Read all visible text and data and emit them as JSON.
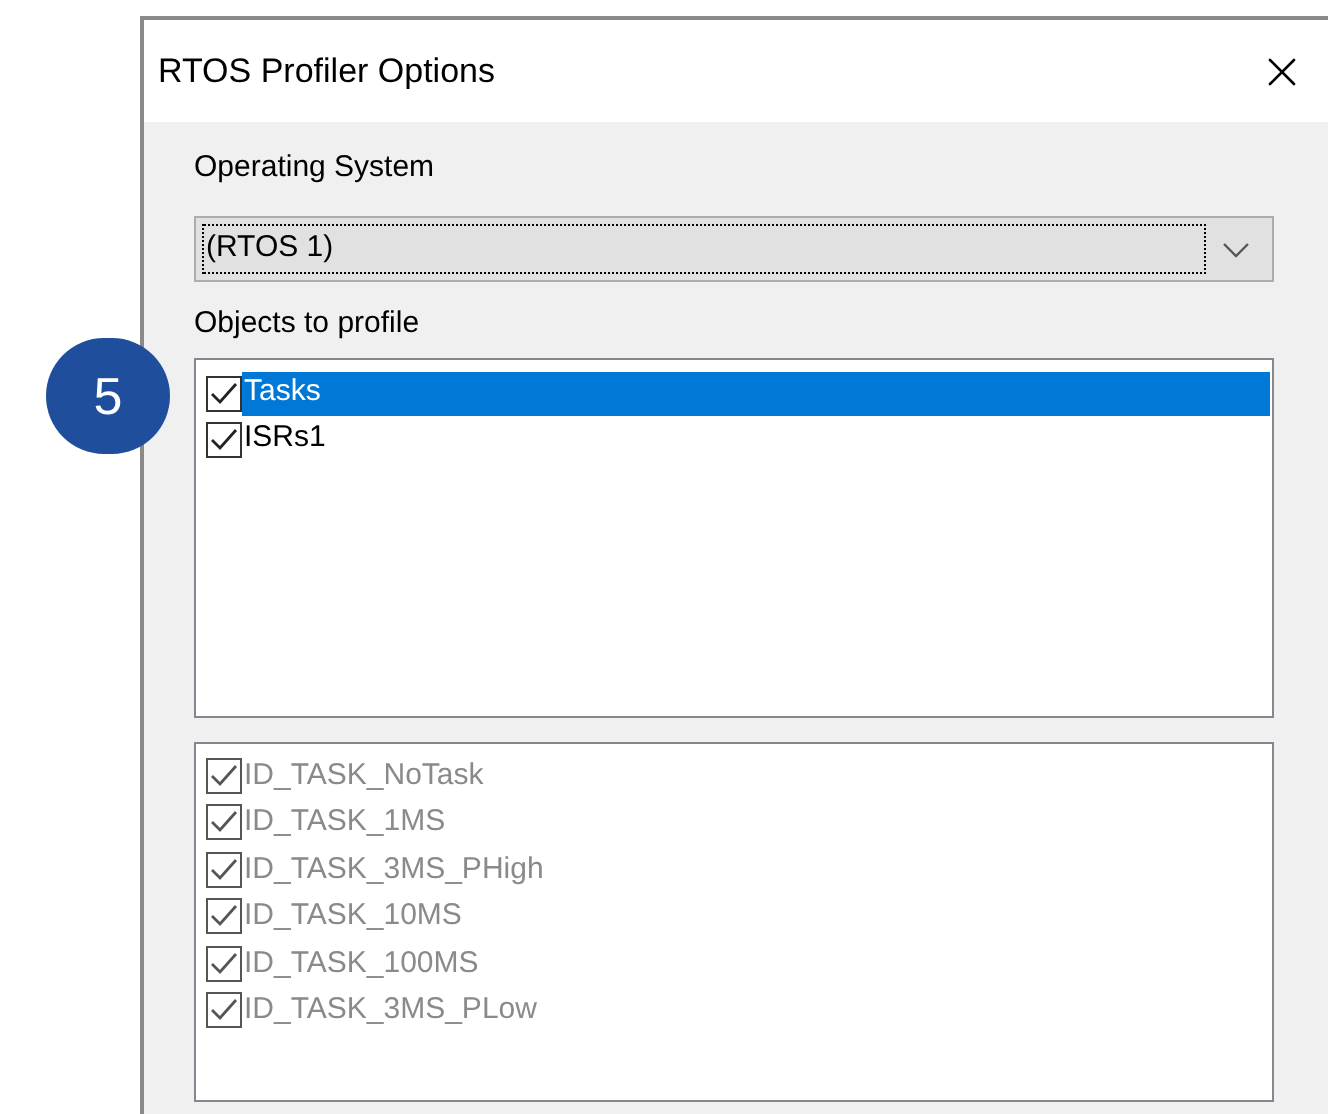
{
  "step_badge": "5",
  "dialog": {
    "title": "RTOS Profiler Options",
    "os_label": "Operating System",
    "os_select": {
      "value": "(RTOS 1)"
    },
    "objects_label": "Objects to profile",
    "objects": [
      {
        "label": "Tasks",
        "checked": true,
        "selected": true
      },
      {
        "label": "ISRs1",
        "checked": true,
        "selected": false
      }
    ],
    "tasks": [
      {
        "label": "ID_TASK_NoTask",
        "checked": true,
        "disabled": true
      },
      {
        "label": "ID_TASK_1MS",
        "checked": true,
        "disabled": true
      },
      {
        "label": "ID_TASK_3MS_PHigh",
        "checked": true,
        "disabled": true
      },
      {
        "label": "ID_TASK_10MS",
        "checked": true,
        "disabled": true
      },
      {
        "label": "ID_TASK_100MS",
        "checked": true,
        "disabled": true
      },
      {
        "label": "ID_TASK_3MS_PLow",
        "checked": true,
        "disabled": true
      }
    ]
  }
}
